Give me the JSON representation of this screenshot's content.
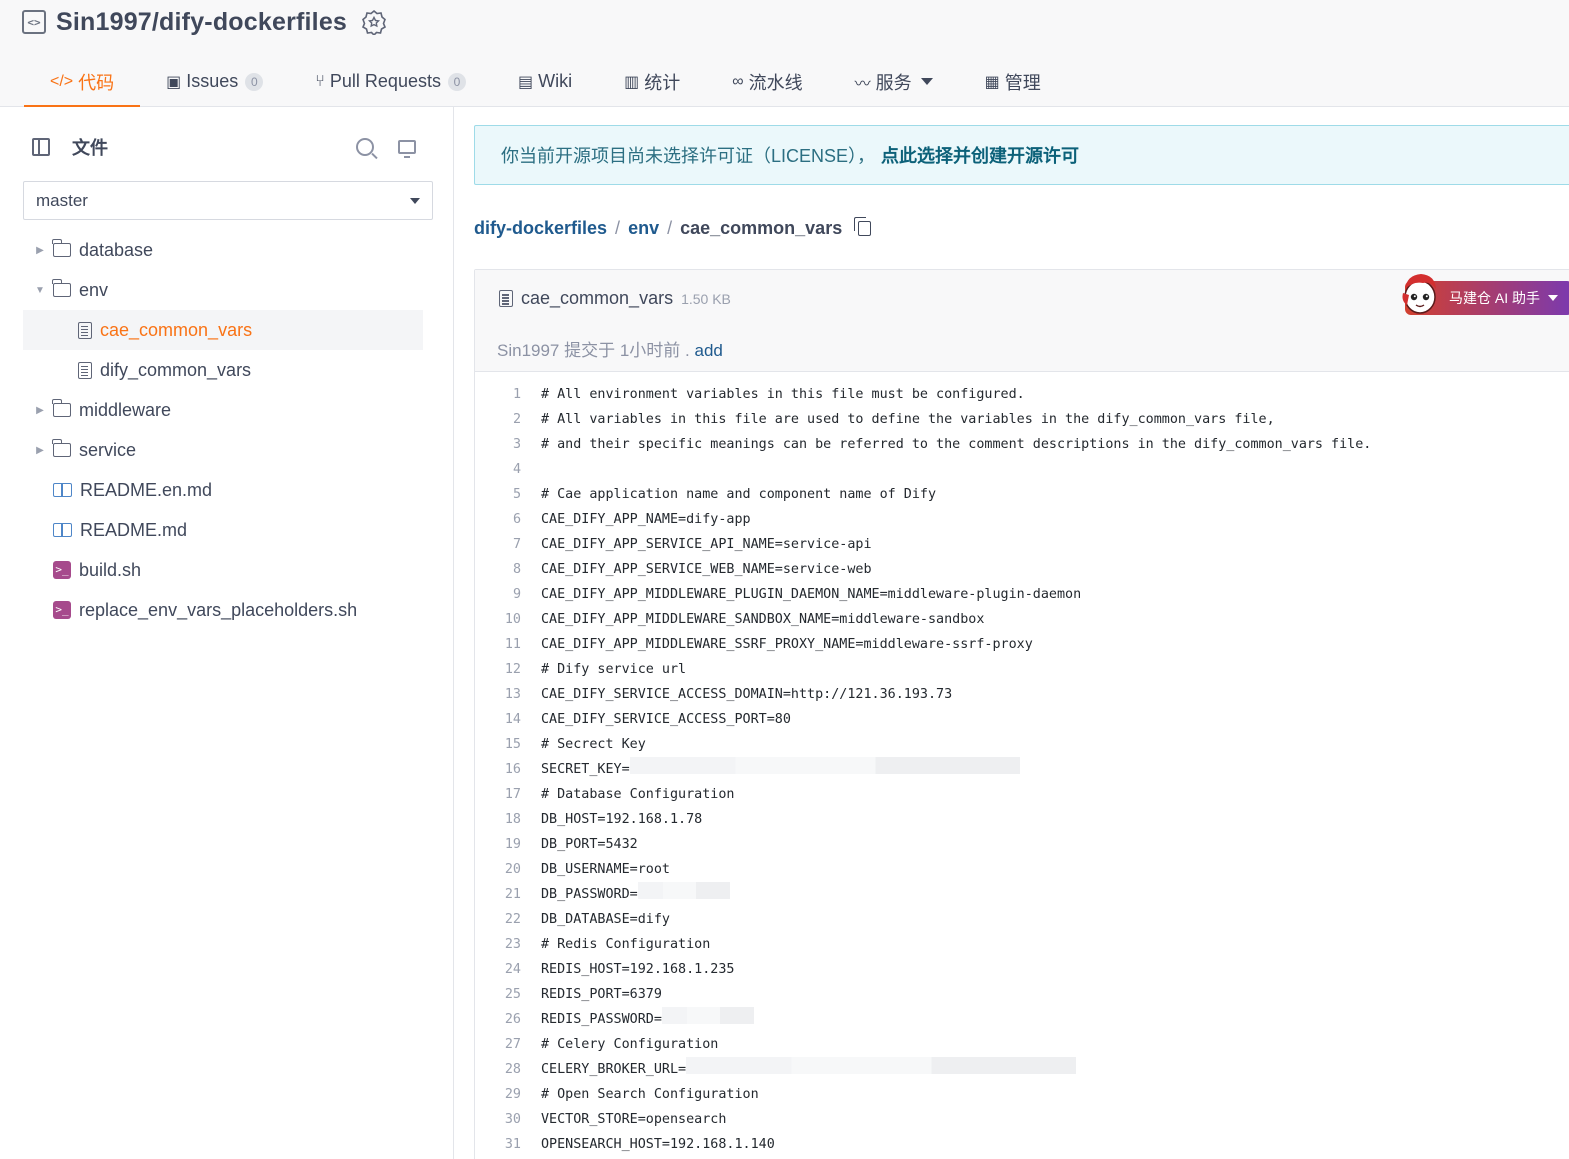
{
  "repo": {
    "full_name": "Sin1997/dify-dockerfiles"
  },
  "tabs": [
    {
      "label": "代码",
      "icon": "code-icon"
    },
    {
      "label": "Issues",
      "icon": "issues-icon",
      "count": "0"
    },
    {
      "label": "Pull Requests",
      "icon": "pull-request-icon",
      "count": "0"
    },
    {
      "label": "Wiki",
      "icon": "wiki-icon"
    },
    {
      "label": "统计",
      "icon": "stats-icon"
    },
    {
      "label": "流水线",
      "icon": "pipeline-icon"
    },
    {
      "label": "服务",
      "icon": "pulse-icon"
    },
    {
      "label": "管理",
      "icon": "manage-icon"
    }
  ],
  "sidebar": {
    "title": "文件",
    "branch": "master",
    "tree": [
      {
        "label": "database",
        "type": "folder",
        "expanded": false
      },
      {
        "label": "env",
        "type": "folder",
        "expanded": true
      },
      {
        "label": "cae_common_vars",
        "type": "file",
        "selected": true
      },
      {
        "label": "dify_common_vars",
        "type": "file"
      },
      {
        "label": "middleware",
        "type": "folder",
        "expanded": false
      },
      {
        "label": "service",
        "type": "folder",
        "expanded": false
      },
      {
        "label": "README.en.md",
        "type": "readme"
      },
      {
        "label": "README.md",
        "type": "readme"
      },
      {
        "label": "build.sh",
        "type": "shell"
      },
      {
        "label": "replace_env_vars_placeholders.sh",
        "type": "shell"
      }
    ]
  },
  "license": {
    "text": "你当前开源项目尚未选择许可证（LICENSE），",
    "link": "点此选择并创建开源许可"
  },
  "breadcrumb": {
    "root": "dify-dockerfiles",
    "folder": "env",
    "file": "cae_common_vars"
  },
  "file": {
    "name": "cae_common_vars",
    "size": "1.50 KB",
    "commit_text": "Sin1997 提交于 1小时前 .",
    "commit_link": "add"
  },
  "ai_assistant": {
    "label": "马建仓 AI 助手"
  },
  "code_lines": [
    {
      "n": "1",
      "text": "# All environment variables in this file must be configured."
    },
    {
      "n": "2",
      "text": "# All variables in this file are used to define the variables in the dify_common_vars file,"
    },
    {
      "n": "3",
      "text": "# and their specific meanings can be referred to the comment descriptions in the dify_common_vars file."
    },
    {
      "n": "4",
      "text": ""
    },
    {
      "n": "5",
      "text": "# Cae application name and component name of Dify"
    },
    {
      "n": "6",
      "text": "CAE_DIFY_APP_NAME=dify-app"
    },
    {
      "n": "7",
      "text": "CAE_DIFY_APP_SERVICE_API_NAME=service-api"
    },
    {
      "n": "8",
      "text": "CAE_DIFY_APP_SERVICE_WEB_NAME=service-web"
    },
    {
      "n": "9",
      "text": "CAE_DIFY_APP_MIDDLEWARE_PLUGIN_DAEMON_NAME=middleware-plugin-daemon"
    },
    {
      "n": "10",
      "text": "CAE_DIFY_APP_MIDDLEWARE_SANDBOX_NAME=middleware-sandbox"
    },
    {
      "n": "11",
      "text": "CAE_DIFY_APP_MIDDLEWARE_SSRF_PROXY_NAME=middleware-ssrf-proxy"
    },
    {
      "n": "12",
      "text": "# Dify service url"
    },
    {
      "n": "13",
      "text": "CAE_DIFY_SERVICE_ACCESS_DOMAIN=http://121.36.193.73"
    },
    {
      "n": "14",
      "text": "CAE_DIFY_SERVICE_ACCESS_PORT=80"
    },
    {
      "n": "15",
      "text": "# Secrect Key"
    },
    {
      "n": "16",
      "text": "SECRET_KEY=",
      "redacted": "long"
    },
    {
      "n": "17",
      "text": "# Database Configuration"
    },
    {
      "n": "18",
      "text": "DB_HOST=192.168.1.78"
    },
    {
      "n": "19",
      "text": "DB_PORT=5432"
    },
    {
      "n": "20",
      "text": "DB_USERNAME=root"
    },
    {
      "n": "21",
      "text": "DB_PASSWORD=",
      "redacted": "short"
    },
    {
      "n": "22",
      "text": "DB_DATABASE=dify"
    },
    {
      "n": "23",
      "text": "# Redis Configuration"
    },
    {
      "n": "24",
      "text": "REDIS_HOST=192.168.1.235"
    },
    {
      "n": "25",
      "text": "REDIS_PORT=6379"
    },
    {
      "n": "26",
      "text": "REDIS_PASSWORD=",
      "redacted": "short"
    },
    {
      "n": "27",
      "text": "# Celery Configuration"
    },
    {
      "n": "28",
      "text": "CELERY_BROKER_URL=",
      "redacted": "long"
    },
    {
      "n": "29",
      "text": "# Open Search Configuration"
    },
    {
      "n": "30",
      "text": "VECTOR_STORE=opensearch"
    },
    {
      "n": "31",
      "text": "OPENSEARCH_HOST=192.168.1.140"
    }
  ],
  "colors": {
    "accent": "#f97316",
    "link": "#1f5a8e",
    "license_bg": "#ebf8fb"
  }
}
